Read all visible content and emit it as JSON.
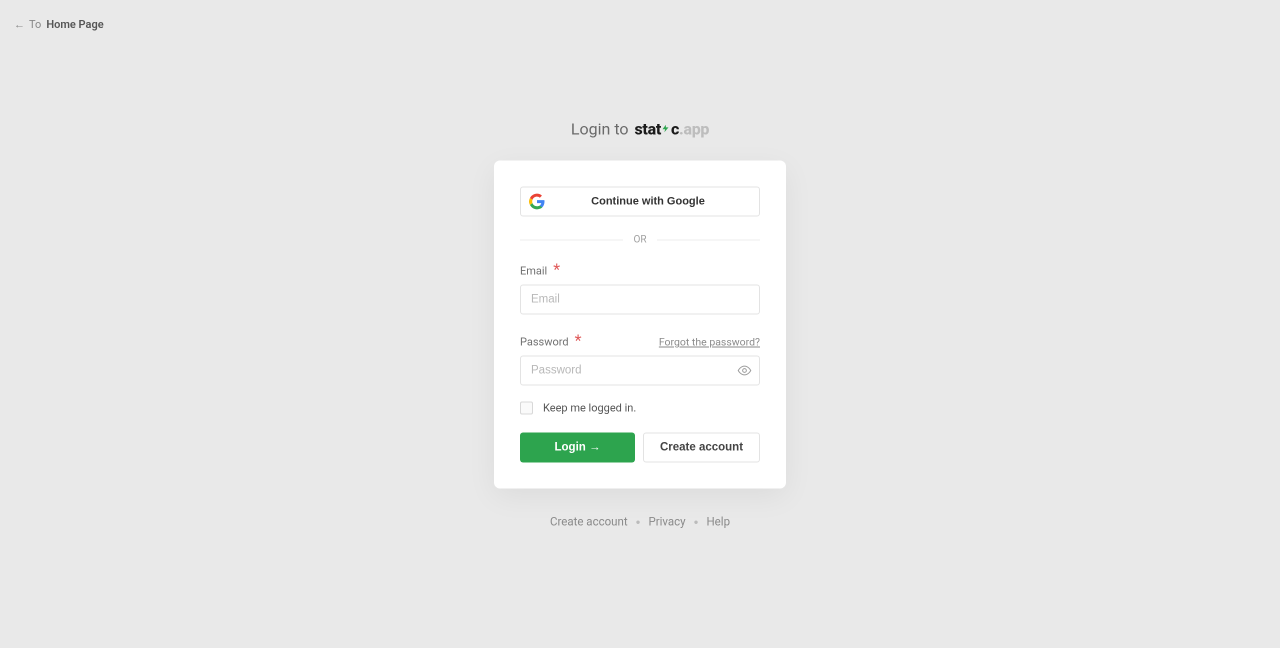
{
  "nav": {
    "back_arrow": "←",
    "to_label": "To",
    "home_label": "Home Page"
  },
  "heading": {
    "prefix": "Login to",
    "brand_pre": "stat",
    "brand_post": "c",
    "brand_suffix": ".app"
  },
  "oauth": {
    "google_label": "Continue with Google"
  },
  "divider": {
    "label": "OR"
  },
  "email": {
    "label": "Email",
    "placeholder": "Email",
    "value": ""
  },
  "password": {
    "label": "Password",
    "placeholder": "Password",
    "value": "",
    "forgot_label": "Forgot the password?"
  },
  "remember": {
    "label": "Keep me logged in.",
    "checked": false
  },
  "buttons": {
    "login_label": "Login →",
    "create_label": "Create account"
  },
  "footer": {
    "create_label": "Create account",
    "privacy_label": "Privacy",
    "help_label": "Help"
  }
}
